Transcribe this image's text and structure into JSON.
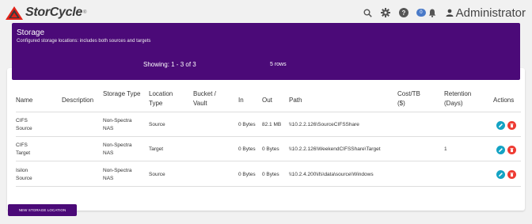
{
  "app": {
    "brand": "StorCycle",
    "brand_mark": "®"
  },
  "topbar": {
    "icons": [
      "search-icon",
      "gear-icon",
      "help-icon",
      "toggle-badge",
      "bell-icon",
      "user-icon"
    ],
    "badge_text": "0",
    "user_name": "Administrator"
  },
  "header": {
    "title": "Storage",
    "subtitle": "Configured storage locations: includes both sources and targets",
    "showing": "Showing: 1 - 3 of 3",
    "rows": "5 rows"
  },
  "table": {
    "columns": [
      "Name",
      "Description",
      "Storage Type",
      "Location Type",
      "Bucket / Vault",
      "In",
      "Out",
      "Path",
      "Cost/TB ($)",
      "Retention (Days)",
      "Actions"
    ],
    "rows": [
      {
        "name": "CIFS Source",
        "description": "",
        "storage_type": "Non-Spectra NAS",
        "location_type": "Source",
        "bucket": "",
        "in": "0 Bytes",
        "out": "82.1 MB",
        "path": "\\\\10.2.2.126\\SourceCIFSShare",
        "cost": "",
        "retention": ""
      },
      {
        "name": "CIFS Target",
        "description": "",
        "storage_type": "Non-Spectra NAS",
        "location_type": "Target",
        "bucket": "",
        "in": "0 Bytes",
        "out": "0 Bytes",
        "path": "\\\\10.2.2.126\\WeekendCIFSShare\\Target",
        "cost": "",
        "retention": "1"
      },
      {
        "name": "Isilon Source",
        "description": "",
        "storage_type": "Non-Spectra NAS",
        "location_type": "Source",
        "bucket": "",
        "in": "0 Bytes",
        "out": "0 Bytes",
        "path": "\\\\10.2.4.200\\ifs\\data\\source\\Windows",
        "cost": "",
        "retention": ""
      }
    ]
  },
  "buttons": {
    "new_storage_location": "New Storage Location"
  },
  "colors": {
    "brand_purple": "#4b0a78",
    "edit": "#14a3c4",
    "delete": "#ee3b33",
    "badge": "#4a7ac8"
  }
}
